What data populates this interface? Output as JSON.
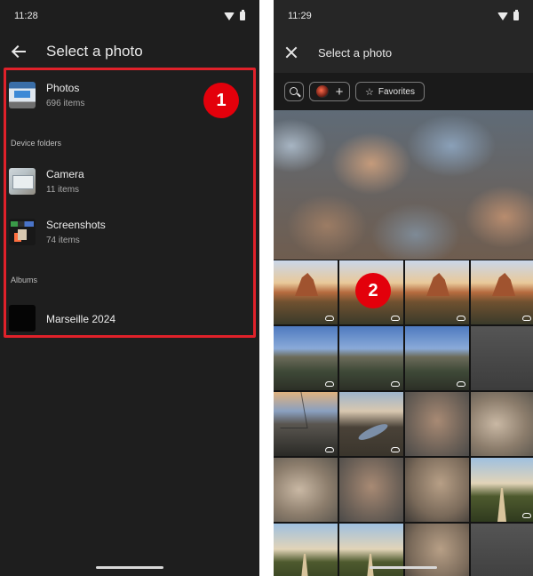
{
  "left": {
    "status_time": "11:28",
    "title": "Select a photo",
    "badge": "1",
    "main_album": {
      "name": "Photos",
      "count": "696 items"
    },
    "device_folders_label": "Device folders",
    "folders": [
      {
        "name": "Camera",
        "count": "11 items"
      },
      {
        "name": "Screenshots",
        "count": "74 items"
      }
    ],
    "albums_label": "Albums",
    "albums": [
      {
        "name": "Marseille 2024"
      }
    ]
  },
  "right": {
    "status_time": "11:29",
    "title": "Select a photo",
    "badge": "2",
    "chips": {
      "favorites": "Favorites"
    }
  },
  "colors": {
    "highlight": "#e0212a",
    "badge": "#e3000b"
  }
}
